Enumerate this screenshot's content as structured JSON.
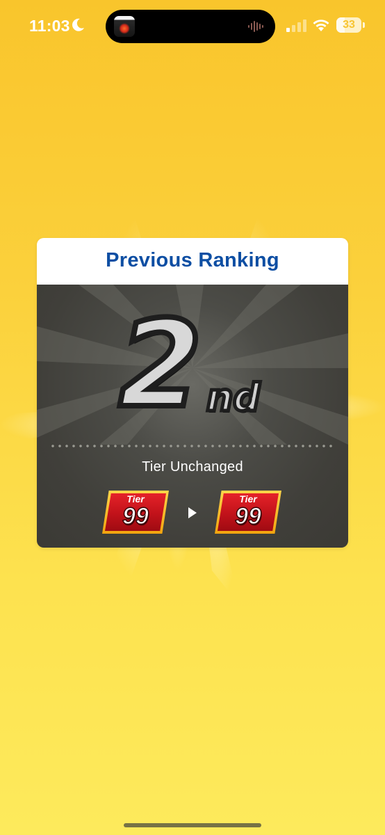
{
  "status_bar": {
    "time": "11:03",
    "battery_percent": "33",
    "icons": [
      "moon-icon",
      "waveform-icon",
      "signal-icon",
      "wifi-icon",
      "battery-icon"
    ]
  },
  "dynamic_island": {
    "app_icon": "starburst-app-icon",
    "activity_icon": "waveform-icon"
  },
  "ranking_card": {
    "title": "Previous Ranking",
    "rank_number": "2",
    "rank_suffix": "nd",
    "tier_status": "Tier Unchanged",
    "tier_from": {
      "label": "Tier",
      "value": "99"
    },
    "tier_to": {
      "label": "Tier",
      "value": "99"
    },
    "arrow_icon": "play-arrow-icon"
  },
  "colors": {
    "background_top": "#f9c52c",
    "background_bottom": "#fdea5c",
    "title_blue": "#0d4ea3",
    "card_body": "#403f3a",
    "badge_red": "#c1121a",
    "badge_gold": "#f2a40f"
  }
}
